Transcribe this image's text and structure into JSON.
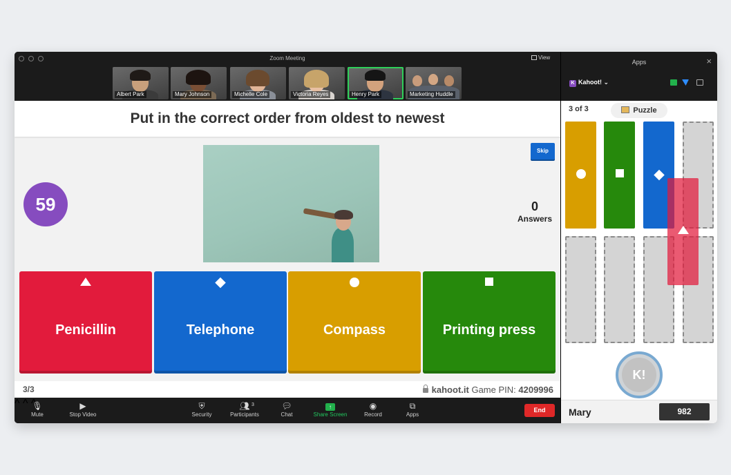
{
  "window": {
    "title": "Zoom Meeting",
    "view_label": "View"
  },
  "participants": [
    {
      "name": "Albert Park"
    },
    {
      "name": "Mary Johnson"
    },
    {
      "name": "Michelle Cole"
    },
    {
      "name": "Victoria Reyes"
    },
    {
      "name": "Henry Park"
    },
    {
      "name": "Marketing Huddle"
    }
  ],
  "question": {
    "text": "Put in the correct order from oldest to newest",
    "timer": "59",
    "skip_label": "Skip",
    "answers_count": "0",
    "answers_label": "Answers"
  },
  "answers": [
    {
      "label": "Penicillin",
      "shape": "triangle",
      "color": "#e21b3c"
    },
    {
      "label": "Telephone",
      "shape": "diamond",
      "color": "#1368ce"
    },
    {
      "label": "Compass",
      "shape": "circle",
      "color": "#d89e00"
    },
    {
      "label": "Printing press",
      "shape": "square",
      "color": "#26890c"
    }
  ],
  "footer": {
    "counter": "3/3",
    "site": "kahoot.it",
    "pin_label": "Game PIN:",
    "pin": "4209996"
  },
  "toolbar": {
    "mute": "Mute",
    "stop_video": "Stop Video",
    "security": "Security",
    "participants": "Participants",
    "participants_count": "3",
    "chat": "Chat",
    "share_screen": "Share Screen",
    "record": "Record",
    "apps": "Apps",
    "end": "End"
  },
  "apps_panel": {
    "title": "Apps",
    "app_name": "Kahoot!",
    "progress": "3 of 3",
    "mode": "Puzzle",
    "slots_top": [
      {
        "shape": "circle",
        "color": "#d89e00"
      },
      {
        "shape": "square",
        "color": "#26890c"
      },
      {
        "shape": "diamond",
        "color": "#1368ce"
      },
      {
        "shape": "empty"
      }
    ],
    "dragging": {
      "shape": "triangle",
      "color": "#e21b3c"
    },
    "kahoot_button_label": "K!",
    "player": {
      "name": "Mary",
      "score": "982"
    }
  }
}
